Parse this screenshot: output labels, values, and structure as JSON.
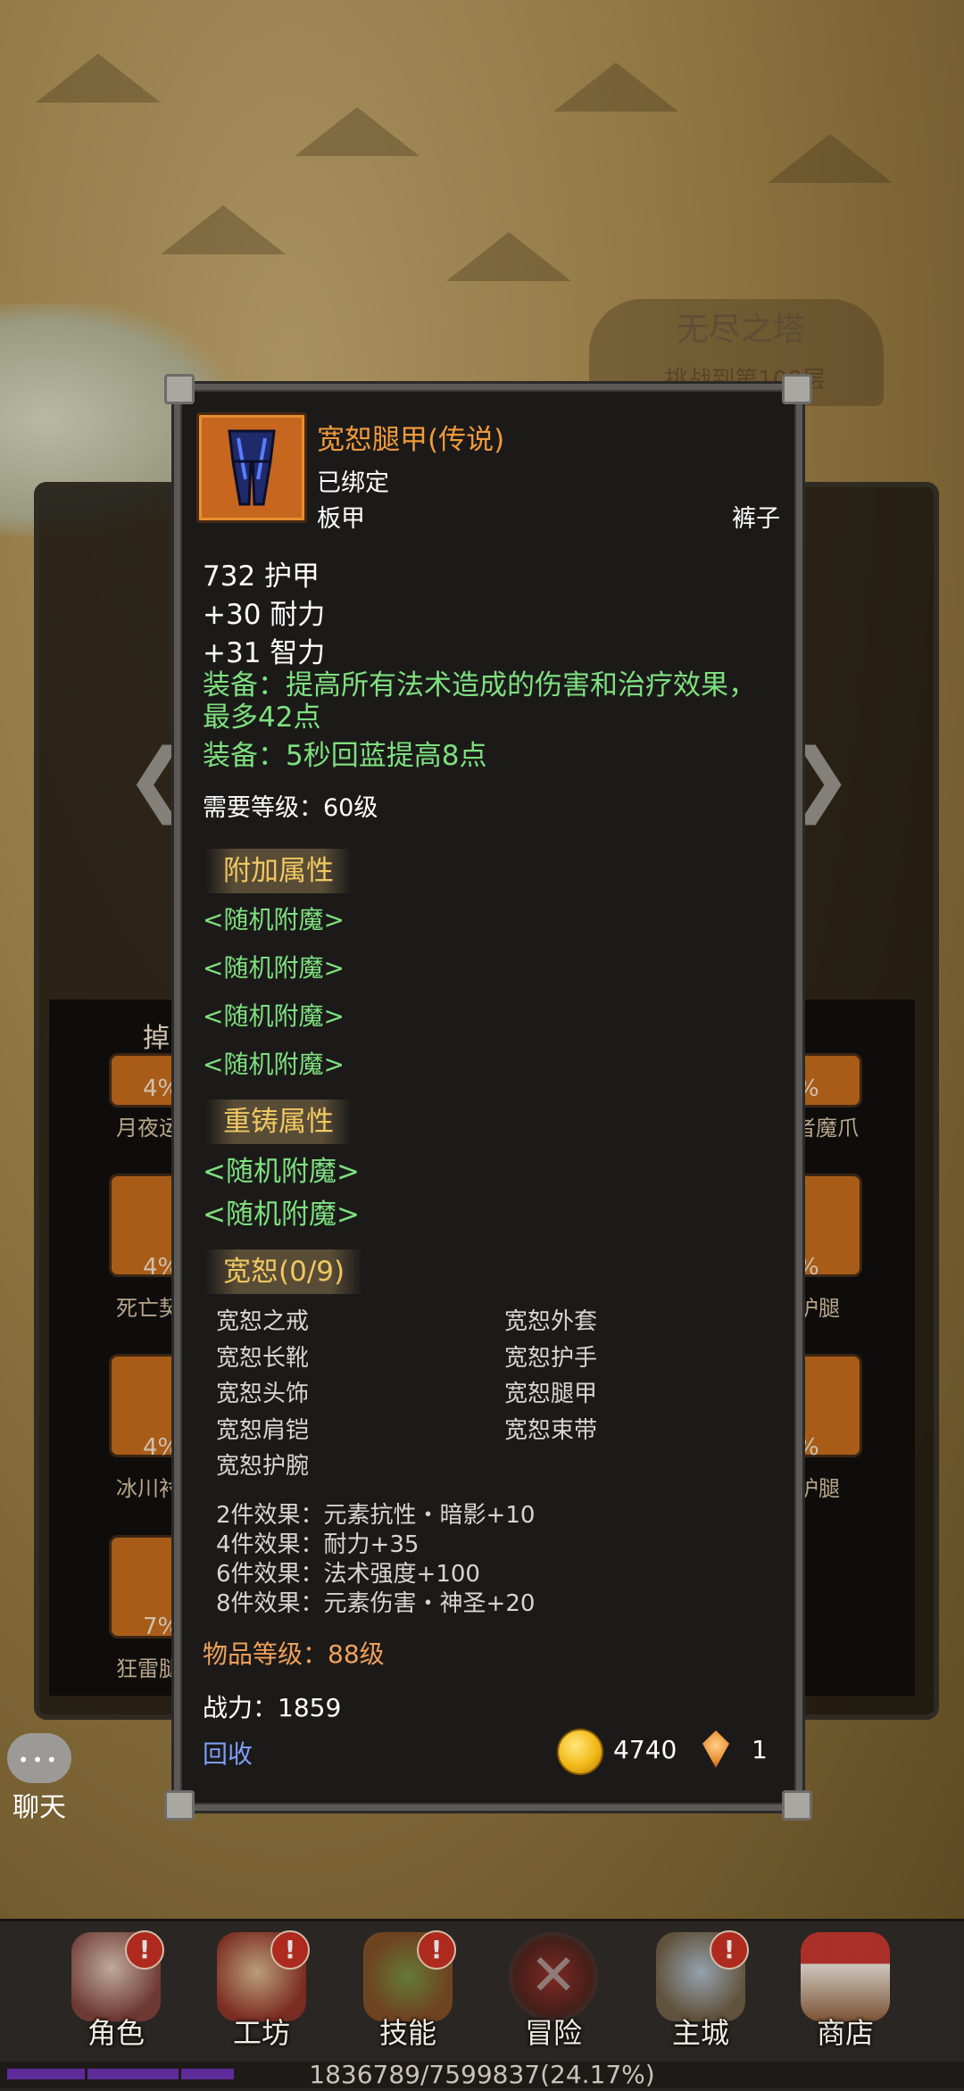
{
  "background": {
    "tower_title": "无尽之塔",
    "tower_sub": "挑战到第100层",
    "drop_tab": "掉",
    "slots": [
      {
        "pct": "4%",
        "name": "月夜运"
      },
      {
        "pct": "4%",
        "name": "死亡契"
      },
      {
        "pct": "4%",
        "name": "冰川衬"
      },
      {
        "pct": "7%",
        "name": "狂雷腿"
      },
      {
        "pct": "%",
        "name": "者魔爪"
      },
      {
        "pct": "%",
        "name": "护腿"
      },
      {
        "pct": "%",
        "name": "护腿"
      }
    ]
  },
  "tooltip": {
    "item_name": "宽恕腿甲(传说)",
    "bound": "已绑定",
    "armor_type": "板甲",
    "slot": "裤子",
    "stats": [
      "732 护甲",
      "+30 耐力",
      "+31 智力"
    ],
    "equip_effects": [
      "装备：提高所有法术造成的伤害和治疗效果，最多42点",
      "装备：5秒回蓝提高8点"
    ],
    "required_level": "需要等级：60级",
    "extra_header": "附加属性",
    "extra_attrs": [
      "<随机附魔>",
      "<随机附魔>",
      "<随机附魔>",
      "<随机附魔>"
    ],
    "reforge_header": "重铸属性",
    "reforge_attrs": [
      "<随机附魔>",
      "<随机附魔>"
    ],
    "set_header": "宽恕(0/9)",
    "set_items": [
      "宽恕之戒",
      "宽恕外套",
      "宽恕长靴",
      "宽恕护手",
      "宽恕头饰",
      "宽恕腿甲",
      "宽恕肩铠",
      "宽恕束带",
      "宽恕护腕"
    ],
    "set_bonuses": [
      "2件效果：元素抗性・暗影+10",
      "4件效果：耐力+35",
      "6件效果：法术强度+100",
      "8件效果：元素伤害・神圣+20"
    ],
    "item_level": "物品等级：88级",
    "power": "战力：1859",
    "recycle": "回收",
    "gold": "4740",
    "gems": "1"
  },
  "chat": {
    "label": "聊天"
  },
  "nav": [
    {
      "label": "角色",
      "badge": "!"
    },
    {
      "label": "工坊",
      "badge": "!"
    },
    {
      "label": "技能",
      "badge": "!"
    },
    {
      "label": "冒险",
      "badge": ""
    },
    {
      "label": "主城",
      "badge": "!"
    },
    {
      "label": "商店",
      "badge": ""
    }
  ],
  "xp": {
    "text": "1836789/7599837(24.17%)",
    "progress": 0.2417
  },
  "colors": {
    "legendary": "#f09a3c",
    "green": "#7ee07e",
    "gold_header": "#f0c860",
    "link": "#7e9ef5"
  }
}
